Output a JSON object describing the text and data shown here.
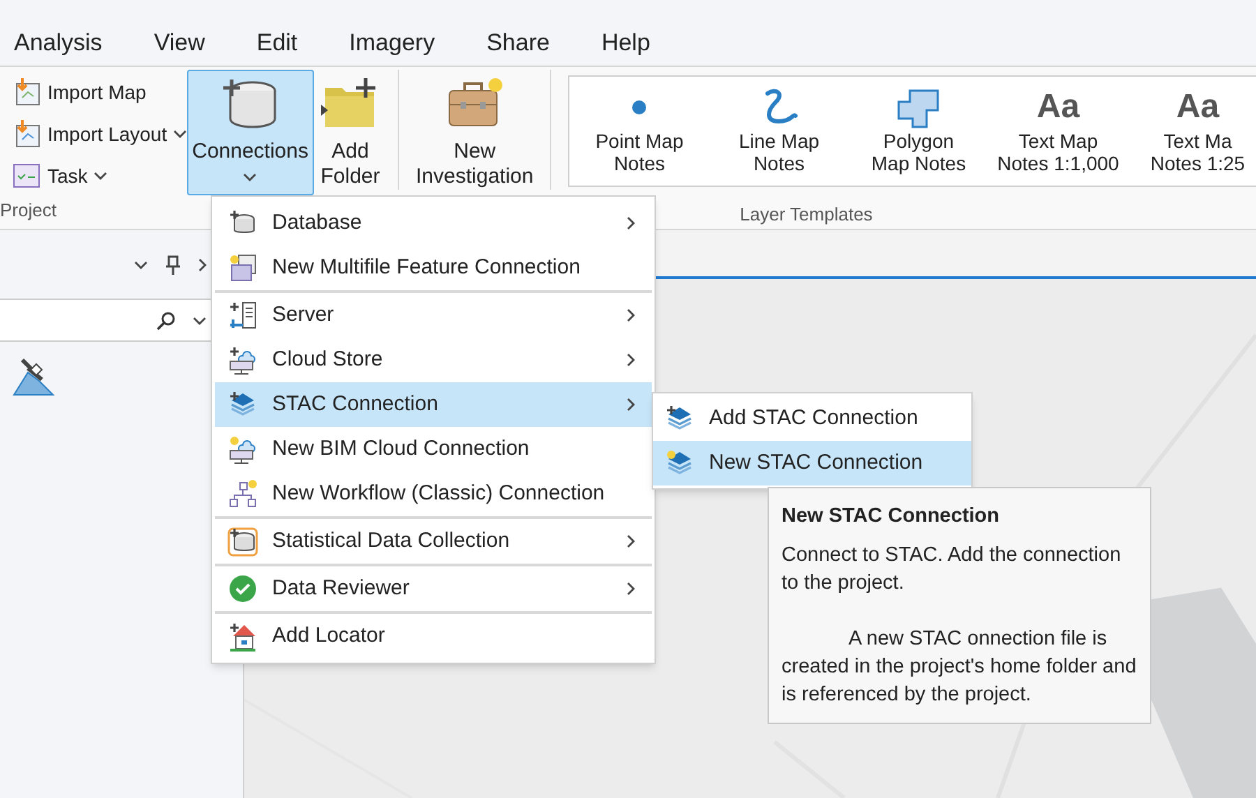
{
  "tabs": [
    {
      "label": "Analysis"
    },
    {
      "label": "View"
    },
    {
      "label": "Edit"
    },
    {
      "label": "Imagery"
    },
    {
      "label": "Share"
    },
    {
      "label": "Help"
    }
  ],
  "ribbon": {
    "project_group": {
      "label": "Project",
      "items": [
        {
          "kind": "import-map",
          "label": "Import Map",
          "dropdown": false
        },
        {
          "kind": "import-layout",
          "label": "Import Layout",
          "dropdown": true
        },
        {
          "kind": "task",
          "label": "Task",
          "dropdown": true
        }
      ]
    },
    "large_buttons": [
      {
        "kind": "database",
        "label": "Connections",
        "selected": true,
        "dropdown": true
      },
      {
        "kind": "folder",
        "label": "Add\nFolder",
        "selected": false,
        "dropdown": false
      },
      {
        "kind": "briefcase",
        "label": "New\nInvestigation",
        "selected": false,
        "dropdown": false
      }
    ],
    "gallery": {
      "label": "Layer Templates",
      "items": [
        {
          "kind": "point",
          "label": "Point Map\nNotes"
        },
        {
          "kind": "line",
          "label": "Line Map\nNotes"
        },
        {
          "kind": "polygon",
          "label": "Polygon\nMap Notes"
        },
        {
          "kind": "text",
          "sample": "Aa",
          "label": "Text Map\nNotes 1:1,000"
        },
        {
          "kind": "text",
          "sample": "Aa",
          "label": "Text Ma\nNotes 1:25"
        }
      ]
    }
  },
  "connections_menu": {
    "sections": [
      {
        "items": [
          {
            "kind": "database",
            "label": "Database",
            "submenu": true,
            "selected": false
          },
          {
            "kind": "multifile",
            "label": "New Multifile Feature Connection",
            "submenu": false,
            "selected": false
          }
        ]
      },
      {
        "items": [
          {
            "kind": "server",
            "label": "Server",
            "submenu": true,
            "selected": false
          },
          {
            "kind": "cloud",
            "label": "Cloud Store",
            "submenu": true,
            "selected": false
          },
          {
            "kind": "stac",
            "label": "STAC Connection",
            "submenu": true,
            "selected": true
          },
          {
            "kind": "bim",
            "label": "New BIM Cloud Connection",
            "submenu": false,
            "selected": false
          },
          {
            "kind": "workflow",
            "label": "New Workflow (Classic) Connection",
            "submenu": false,
            "selected": false
          }
        ]
      },
      {
        "items": [
          {
            "kind": "statistical",
            "label": "Statistical Data Collection",
            "submenu": true,
            "selected": false
          }
        ]
      },
      {
        "items": [
          {
            "kind": "reviewer",
            "label": "Data Reviewer",
            "submenu": true,
            "selected": false
          }
        ]
      },
      {
        "items": [
          {
            "kind": "locator",
            "label": "Add Locator",
            "submenu": false,
            "selected": false
          }
        ]
      }
    ]
  },
  "stac_submenu": {
    "items": [
      {
        "kind": "stac-add",
        "label": "Add STAC Connection",
        "selected": false
      },
      {
        "kind": "stac-new",
        "label": "New STAC Connection",
        "selected": true
      }
    ]
  },
  "tooltip": {
    "title": "New STAC Connection",
    "paragraphs": [
      "Connect to STAC. Add the connection to the project.",
      "A new STAC onnection file is created in the project's home folder and is referenced by the project."
    ]
  }
}
